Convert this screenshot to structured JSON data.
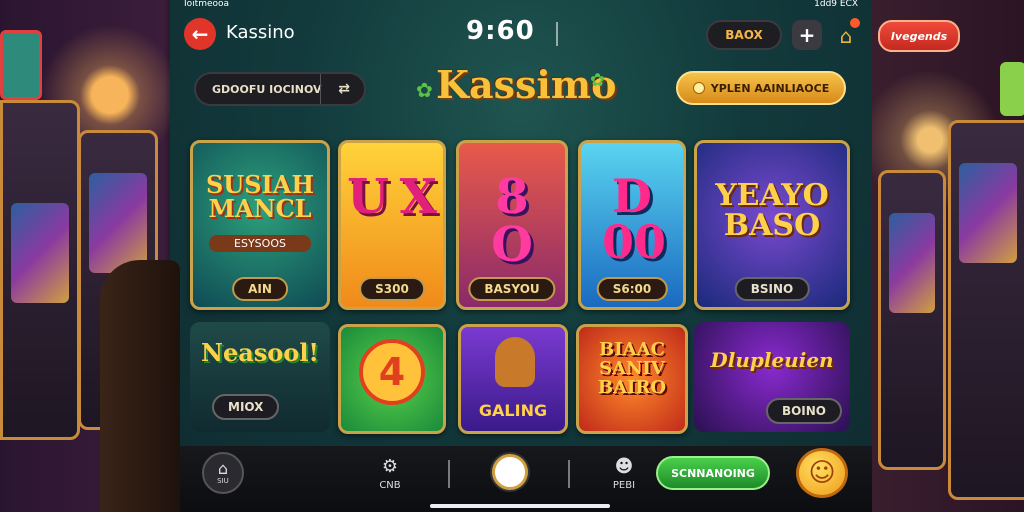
{
  "status_bar": {
    "left": "Ioitmeooa",
    "right": "1dd9 ECX"
  },
  "header": {
    "app_title": "Kassino",
    "clock": "9:60",
    "badge_button": "BAOX",
    "right_button": "Ivegends"
  },
  "search": {
    "label": "GDOOFU IOCINOV"
  },
  "logo": {
    "text": "Kassimo"
  },
  "promo_button": {
    "label": "YPLEN AAINLIAOCE"
  },
  "games_row1": [
    {
      "title": "SUSIAH MANCL",
      "sub": "ESYSOOS",
      "label": "AIN"
    },
    {
      "title": "U X",
      "sub": "",
      "label": "S300"
    },
    {
      "title": "8 O",
      "sub": "",
      "label": "BASYOU"
    },
    {
      "title": "D 00",
      "sub": "",
      "label": "S6:00"
    },
    {
      "title": "YEAYO BASO",
      "sub": "",
      "label": "BSINO"
    }
  ],
  "games_row2": [
    {
      "title": "Neasool!",
      "label": "MIOX"
    },
    {
      "title": "4",
      "label": ""
    },
    {
      "title": "",
      "label": "GALING"
    },
    {
      "title": "BIAAC SANIV BAIRO",
      "label": ""
    },
    {
      "title": "Dlupleuien",
      "label": "BOINO"
    }
  ],
  "bottom_bar": {
    "home_label": "SIU",
    "cog_label": "CNB",
    "people_label": "PEBI",
    "action_button": "SCNNANOING"
  },
  "colors": {
    "accent_green": "#2fa63a",
    "gold": "#f0b233",
    "red": "#e23a2a"
  }
}
